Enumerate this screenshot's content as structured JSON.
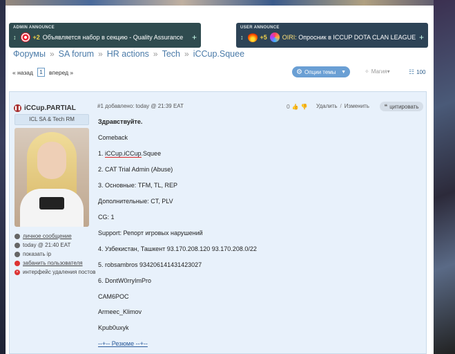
{
  "announcements": {
    "admin": {
      "label": "ADMIN ANNOUNCE",
      "count": "+2",
      "text": "Объявляется набор в секцию - Quality Assurance"
    },
    "user": {
      "label": "USER ANNOUNCE",
      "count": "+5",
      "text_prefix": "OIRI: ",
      "text": "Опросник в ICCUP DOTA CLAN LEAGUE"
    }
  },
  "breadcrumb": [
    "Форумы",
    "SA forum",
    "HR actions",
    "Tech",
    "iCCup.Squee"
  ],
  "pager": {
    "prev": "« назад",
    "page": "1",
    "next": "вперед »"
  },
  "toolbar": {
    "options_label": "Опции темы",
    "magic_label": "Магия",
    "count_label": "100"
  },
  "post": {
    "author": "iCCup.PARTIAL",
    "rank": "ICL SA & Tech RM",
    "meta": "#1 добавлено: today @ 21:39 EAT",
    "votes": "0",
    "delete_label": "Удалить",
    "edit_label": "Изменить",
    "quote_label": "цитировать",
    "side_links": [
      {
        "label": "личное сообщение",
        "link": true
      },
      {
        "label": "today @ 21:40 EAT",
        "link": false
      },
      {
        "label": "показать ip",
        "link": false
      },
      {
        "label": "забанить пользователя",
        "link": true
      },
      {
        "label": "интерфейс удаления постов",
        "link": false
      }
    ],
    "lines": {
      "greeting": "Здравствуйте.",
      "l1": "Comeback",
      "l2_prefix": "1. ",
      "l2_name": "iCCup.iCCup",
      "l2_suffix": ".Squee",
      "l3": "2. CAT Trial Admin (Abuse)",
      "l4": "3. Основные: TFM, TL, REP",
      "l5": "Дополнительные: CT, PLV",
      "l6": "CG: 1",
      "l7": "Support: Репорт игровых нарушений",
      "l8": "4. Узбекистан, Ташкент 93.170.208.120 93.170.208.0/22",
      "l9": "5. robsambros 934206141431423027",
      "l10": "6. DontW0rryImPro",
      "l11": "CAM6POC",
      "l12": "Armeec_Klimov",
      "l13": "Kpub0uxyk",
      "l14": "--+-- Резюме --+--"
    }
  },
  "colors": {
    "accent": "#4a7aa8",
    "announce_bg": "#2f4b4f",
    "post_bg": "#e8f1fb",
    "options_btn": "#6a9fd4"
  }
}
